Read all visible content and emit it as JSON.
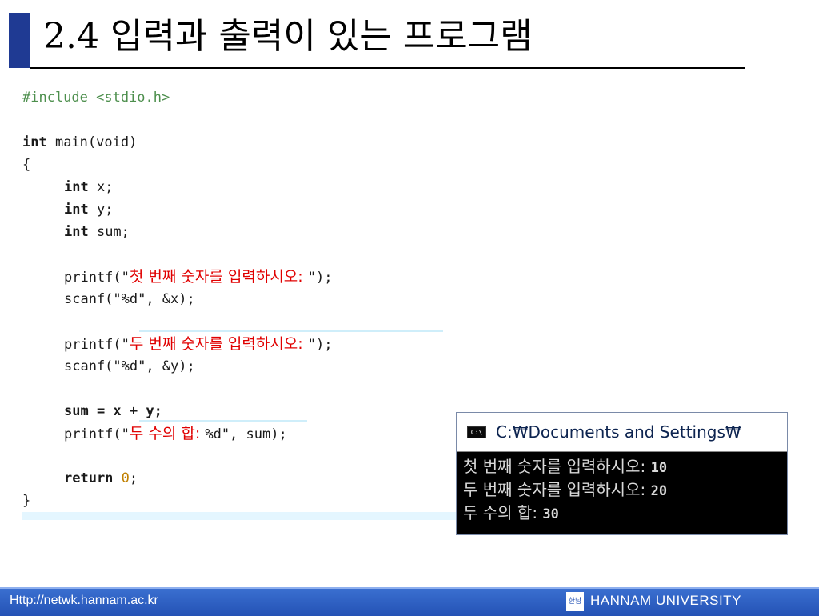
{
  "slide": {
    "title": "2.4 입력과 출력이 있는 프로그램"
  },
  "code": {
    "l01": "#include <stdio.h>",
    "l02_kw": "int",
    "l02_rest": " main(void)",
    "l03": "{",
    "l04_kw": "int",
    "l04_rest": " x;",
    "l05_kw": "int",
    "l05_rest": " y;",
    "l06_kw": "int",
    "l06_rest": " sum;",
    "l07_pre": "printf(\"",
    "l07_kor": "첫 번째 숫자를 입력하시오: ",
    "l07_post": "\");",
    "l08": "scanf(\"%d\", &x);",
    "l09_pre": "printf(\"",
    "l09_kor": "두 번째 숫자를 입력하시오: ",
    "l09_post": "\");",
    "l10": "scanf(\"%d\", &y);",
    "l11": "sum = x + y;",
    "l12_pre": "printf(\"",
    "l12_kor": "두 수의 합: ",
    "l12_post": "%d\", sum);",
    "l13_kw": "return",
    "l13_num": "0",
    "l13_end": ";",
    "l14": "}"
  },
  "console": {
    "icon_text": "C:\\",
    "title": "C:₩Documents and Settings₩",
    "lines": [
      {
        "label": "첫 번째 숫자를 입력하시오: ",
        "value": "10"
      },
      {
        "label": "두 번째 숫자를 입력하시오: ",
        "value": "20"
      },
      {
        "label": "두 수의 합: ",
        "value": "30"
      }
    ]
  },
  "footer": {
    "url": "Http://netwk.hannam.ac.kr",
    "university": "HANNAM UNIVERSITY",
    "logo_text": "한남"
  },
  "colors": {
    "accent_bar": "#1f3a93",
    "footer_bg": "#2452b5",
    "korean_string": "#e00000",
    "preprocessor": "#4d8f4d",
    "numeric_literal": "#c08000"
  }
}
